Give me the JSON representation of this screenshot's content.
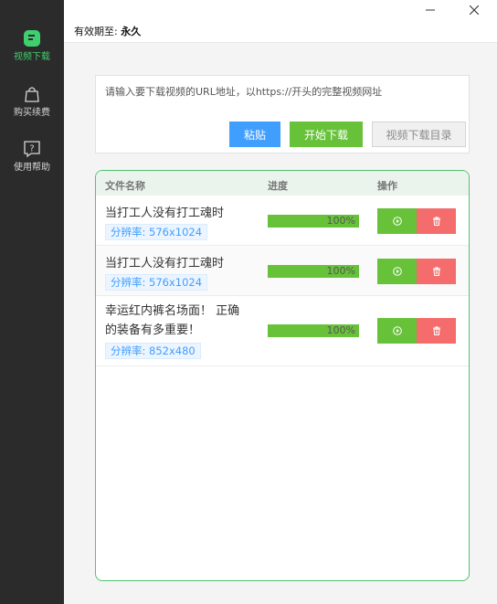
{
  "window": {
    "expiry_label": "有效期至:",
    "expiry_value": "永久",
    "minimize_icon": "minimize-icon",
    "close_icon": "close-icon"
  },
  "sidebar": {
    "items": [
      {
        "label": "视频下载",
        "icon": "video-download-icon",
        "active": true
      },
      {
        "label": "购买续费",
        "icon": "shopping-bag-icon",
        "active": false
      },
      {
        "label": "使用帮助",
        "icon": "help-icon",
        "active": false
      }
    ]
  },
  "url_box": {
    "placeholder": "请输入要下载视频的URL地址，以https://开头的完整视频网址",
    "value": "",
    "paste_label": "粘贴",
    "start_label": "开始下载",
    "dir_label": "视频下载目录"
  },
  "download_list": {
    "columns": [
      "文件名称",
      "进度",
      "操作"
    ],
    "rows": [
      {
        "name": "当打工人没有打工魂时",
        "resolution": "分辨率: 576x1024",
        "progress": 1.0,
        "progress_text": "100%"
      },
      {
        "name": "当打工人没有打工魂时",
        "resolution": "分辨率: 576x1024",
        "progress": 1.0,
        "progress_text": "100%"
      },
      {
        "name": "幸运红内裤名场面！ 正确的装备有多重要！",
        "resolution": "分辨率: 852x480",
        "progress": 1.0,
        "progress_text": "100%"
      }
    ]
  },
  "colors": {
    "accent_green": "#67c23a",
    "accent_blue": "#409eff",
    "danger_red": "#f56c6c",
    "sidebar_bg": "#2b2b2b",
    "sidebar_active": "#3ecf6e"
  }
}
